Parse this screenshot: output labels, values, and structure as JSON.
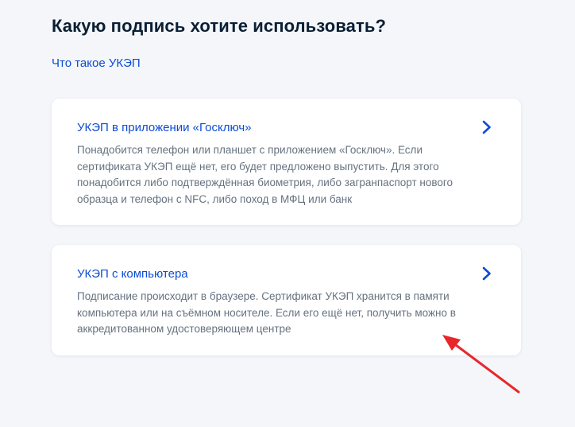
{
  "page": {
    "title": "Какую подпись хотите использовать?",
    "info_link": "Что такое УКЭП"
  },
  "options": [
    {
      "title": "УКЭП в приложении «Госключ»",
      "description": "Понадобится телефон или планшет с приложением «Госключ». Если сертификата УКЭП ещё нет, его будет предложено выпустить. Для этого понадобится либо подтверждённая биометрия, либо загранпаспорт нового образца и телефон с NFC, либо поход в МФЦ или банк",
      "icon": "chevron-right-icon"
    },
    {
      "title": "УКЭП с компьютера",
      "description": "Подписание происходит в браузере. Сертификат УКЭП хранится в памяти компьютера или на съёмном носителе. Если его ещё нет, получить можно в аккредитованном удостоверяющем центре",
      "icon": "chevron-right-icon"
    }
  ],
  "annotation": {
    "icon": "red-arrow-icon",
    "color": "#e8272b"
  },
  "colors": {
    "background": "#f4f6fa",
    "link": "#0d4cd3",
    "heading": "#0b1f33",
    "muted_text": "#66727f"
  }
}
